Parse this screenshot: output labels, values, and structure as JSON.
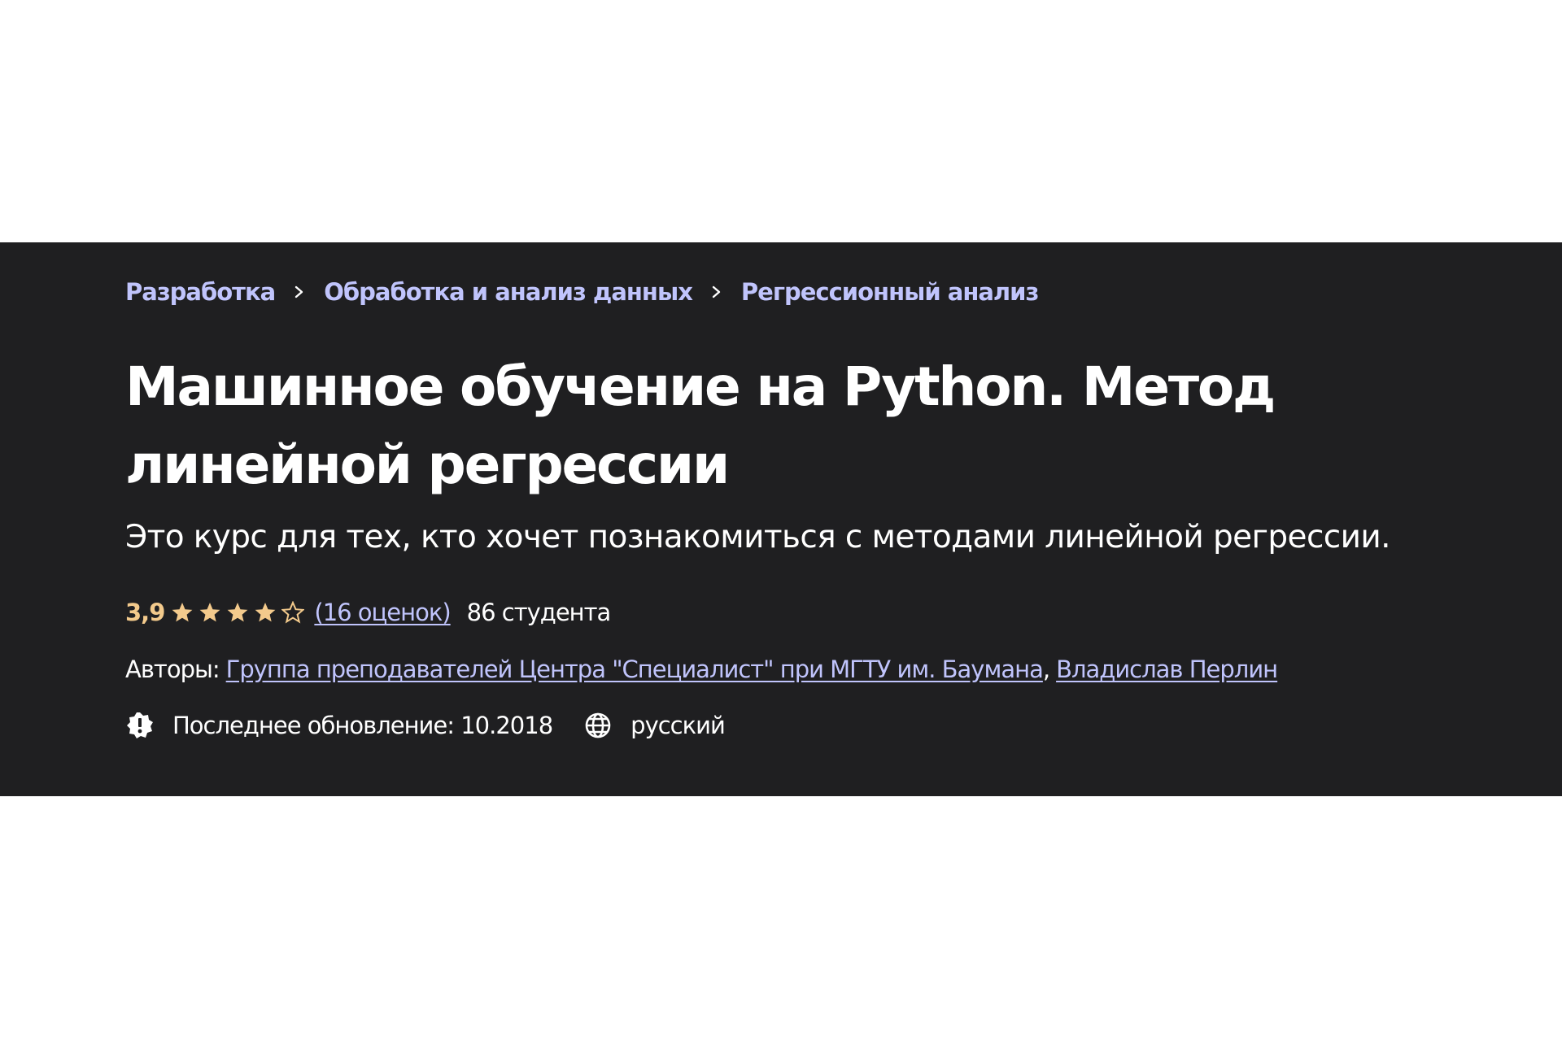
{
  "breadcrumb": {
    "items": [
      {
        "label": "Разработка"
      },
      {
        "label": "Обработка и анализ данных"
      },
      {
        "label": "Регрессионный анализ"
      }
    ]
  },
  "course": {
    "title": "Машинное обучение на Python. Метод линейной регрессии",
    "subtitle": "Это курс для тех, кто хочет познакомиться с методами линейной регрессии.",
    "rating": {
      "value_text": "3,9",
      "value": 3.9,
      "max": 5,
      "count_text": "(16 оценок)"
    },
    "students_text": "86 студента",
    "authors": {
      "label": "Авторы:",
      "list": [
        {
          "name": "Группа преподавателей Центра \"Специалист\" при МГТУ им. Баумана"
        },
        {
          "name": "Владислав Перлин"
        }
      ],
      "separator": ","
    },
    "last_update": "Последнее обновление: 10.2018",
    "language": "русский"
  },
  "icons": {
    "breadcrumb_separator": "chevron-right-icon",
    "update": "alert-badge-icon",
    "language": "globe-icon",
    "star": "star-icon"
  },
  "colors": {
    "banner_bg": "#1f1f21",
    "link": "#c0c4fc",
    "rating": "#f3ca8c",
    "text": "#ffffff"
  }
}
